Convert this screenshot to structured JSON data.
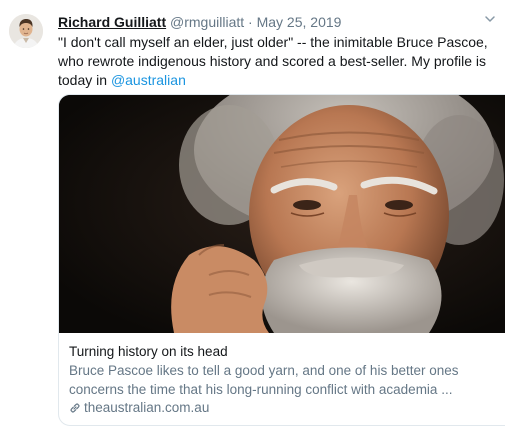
{
  "tweet": {
    "author_name": "Richard Guilliatt",
    "author_handle": "@rmguilliatt",
    "separator": "·",
    "date": "May 25, 2019",
    "text_before_mention": "\"I don't call myself an elder, just older\" -- the inimitable Bruce Pascoe, who rewrote indigenous history and scored a best-seller. My profile is today in ",
    "mention": "@australian"
  },
  "card": {
    "title": "Turning history on its head",
    "description": "Bruce Pascoe likes to tell a good yarn, and one of his better ones concerns the time that his long-running conflict with academia ...",
    "domain": "theaustralian.com.au"
  },
  "icons": {
    "avatar": "avatar",
    "more": "chevron-down-icon",
    "link": "link-icon"
  },
  "colors": {
    "link": "#1b95e0",
    "secondary_text": "#657786",
    "card_border": "#e1e8ed"
  }
}
